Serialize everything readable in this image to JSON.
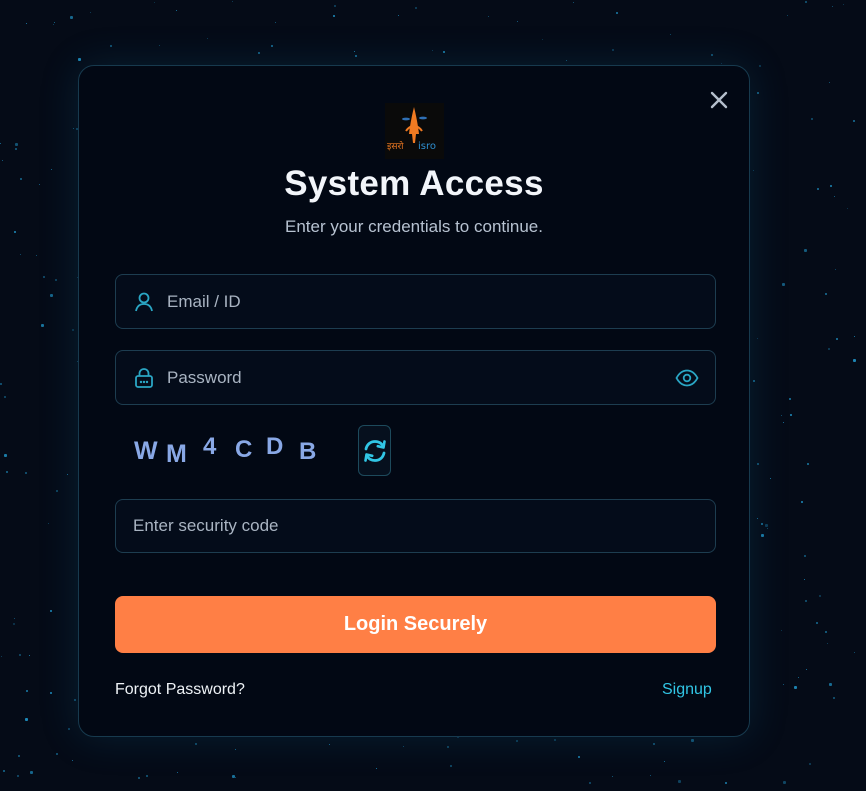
{
  "modal": {
    "title": "System Access",
    "subtitle": "Enter your credentials to continue."
  },
  "logo": {
    "alt": "ISRO logo",
    "text_hindi": "इसरो",
    "text_latin": "isro"
  },
  "form": {
    "email_placeholder": "Email / ID",
    "email_value": "",
    "password_placeholder": "Password",
    "password_value": "",
    "security_placeholder": "Enter security code",
    "security_value": ""
  },
  "captcha": {
    "chars": [
      "W",
      "M",
      "4",
      "C",
      "D",
      "B"
    ]
  },
  "actions": {
    "login_label": "Login Securely",
    "forgot_label": "Forgot Password?",
    "signup_label": "Signup"
  },
  "icons": {
    "close": "close-icon",
    "user": "user-icon",
    "lock": "lock-icon",
    "eye": "eye-icon",
    "refresh": "refresh-icon"
  },
  "colors": {
    "background": "#050b17",
    "accent_button": "#ff7f45",
    "link": "#31c6e6",
    "icon_teal": "#2aa6c4",
    "captcha_text": "#89a8e6"
  }
}
